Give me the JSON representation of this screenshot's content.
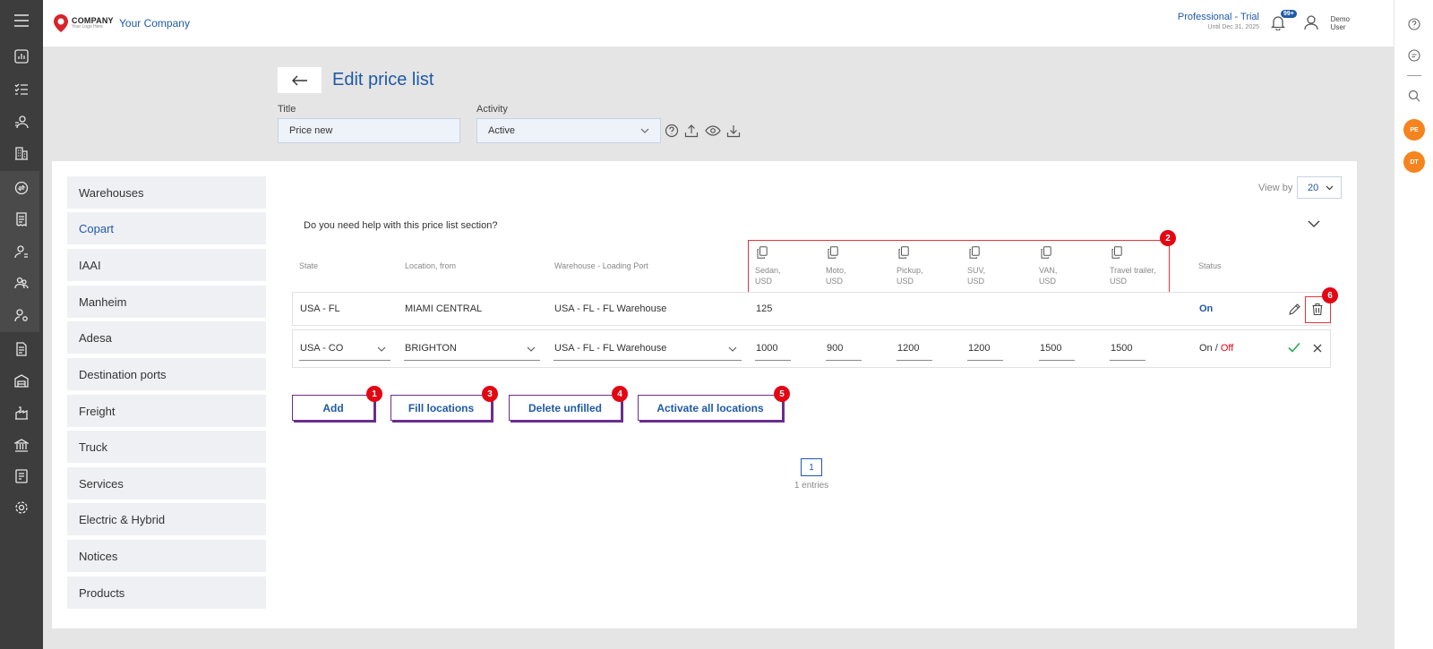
{
  "topbar": {
    "logo_line1": "COMPANY",
    "logo_line2": "Your Logo Here",
    "company_name": "Your Company",
    "plan_name": "Professional - Trial",
    "plan_until": "Until Dec 31, 2025",
    "notifications_badge": "99+",
    "user_first": "Demo",
    "user_last": "User"
  },
  "header": {
    "title": "Edit price list",
    "title_label": "Title",
    "title_value": "Price new",
    "activity_label": "Activity",
    "activity_value": "Active"
  },
  "sidebar": {
    "items": [
      {
        "label": "Warehouses"
      },
      {
        "label": "Copart"
      },
      {
        "label": "IAAI"
      },
      {
        "label": "Manheim"
      },
      {
        "label": "Adesa"
      },
      {
        "label": "Destination ports"
      },
      {
        "label": "Freight"
      },
      {
        "label": "Truck"
      },
      {
        "label": "Services"
      },
      {
        "label": "Electric & Hybrid"
      },
      {
        "label": "Notices"
      },
      {
        "label": "Products"
      }
    ],
    "active_item": "Copart"
  },
  "table": {
    "view_by_label": "View by",
    "view_by_value": "20",
    "help_text": "Do you need help with this price list section?",
    "columns": {
      "state": "State",
      "location": "Location, from",
      "warehouse": "Warehouse - Loading Port",
      "status": "Status",
      "vehicle_types": [
        {
          "name": "Sedan,",
          "unit": "USD"
        },
        {
          "name": "Moto,",
          "unit": "USD"
        },
        {
          "name": "Pickup,",
          "unit": "USD"
        },
        {
          "name": "SUV,",
          "unit": "USD"
        },
        {
          "name": "VAN,",
          "unit": "USD"
        },
        {
          "name": "Travel trailer,",
          "unit": "USD"
        }
      ]
    },
    "rows": [
      {
        "state": "USA - FL",
        "location": "MIAMI CENTRAL",
        "warehouse": "USA - FL - FL Warehouse",
        "sedan": "125",
        "status": "On"
      }
    ],
    "edit_row": {
      "state": "USA - CO",
      "location": "BRIGHTON",
      "warehouse": "USA - FL - FL Warehouse",
      "prices": [
        "1000",
        "900",
        "1200",
        "1200",
        "1500",
        "1500"
      ],
      "status_on": "On",
      "status_sep": " / ",
      "status_off": "Off"
    }
  },
  "actions": {
    "add": "Add",
    "fill_locations": "Fill locations",
    "delete_unfilled": "Delete unfilled",
    "activate_all": "Activate all locations"
  },
  "markers": [
    "1",
    "2",
    "3",
    "4",
    "5",
    "6"
  ],
  "pagination": {
    "page": "1",
    "entries": "1 entries"
  },
  "right_rail": {
    "avatar1": "PE",
    "avatar2": "DT"
  },
  "colors": {
    "accent": "#1f5aa6",
    "marker_red": "#e30613",
    "button_border": "#6b2d8e",
    "rail_dark": "#3d3d3d",
    "status_off": "#e30613",
    "confirm_green": "#2aa84a",
    "avatar_orange": "#f5841f"
  }
}
